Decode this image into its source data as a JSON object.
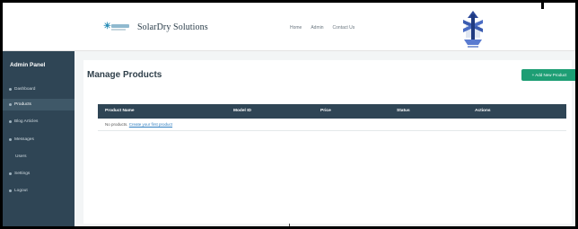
{
  "header": {
    "brand_name": "SolarDry Solutions",
    "nav": [
      "Home",
      "Admin",
      "Contact Us"
    ]
  },
  "sidebar": {
    "title": "Admin Panel",
    "items": [
      {
        "label": "Dashboard",
        "active": false
      },
      {
        "label": "Products",
        "active": true
      },
      {
        "label": "Blog Articles",
        "active": false
      },
      {
        "label": "Messages",
        "active": false
      },
      {
        "label": "Users",
        "active": false
      },
      {
        "label": "Settings",
        "active": false
      },
      {
        "label": "Logout",
        "active": false
      }
    ]
  },
  "main": {
    "title": "Manage Products",
    "add_button_label": "+ Add New Product",
    "table": {
      "columns": [
        "Product Name",
        "Model ID",
        "Price",
        "Status",
        "Actions"
      ],
      "empty_text": "No products.",
      "empty_link": "Create your first product"
    }
  },
  "colors": {
    "sidebar": "#2f4555",
    "accent": "#1d9e74",
    "table_header": "#2f4555",
    "link": "#2f7ec0"
  }
}
